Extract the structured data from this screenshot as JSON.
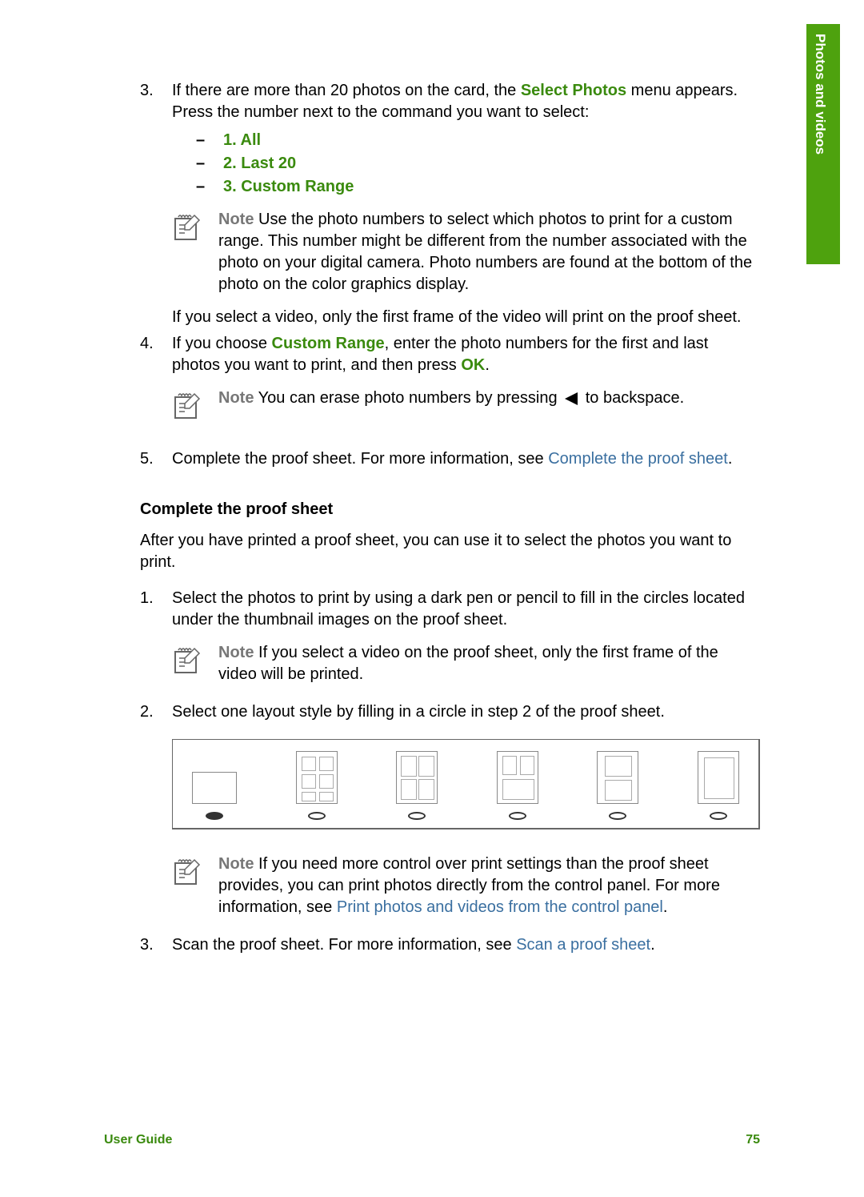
{
  "side_tab": "Photos and videos",
  "step3": {
    "num": "3.",
    "text_a": "If there are more than 20 photos on the card, the ",
    "select_photos": "Select Photos",
    "text_b": " menu appears. Press the number next to the command you want to select:",
    "opt1": "1. All",
    "opt2": "2. Last 20",
    "opt3": "3. Custom Range",
    "note_label": "Note",
    "note_body": "  Use the photo numbers to select which photos to print for a custom range. This number might be different from the number associated with the photo on your digital camera. Photo numbers are found at the bottom of the photo on the color graphics display.",
    "video_line": "If you select a video, only the first frame of the video will print on the proof sheet."
  },
  "step4": {
    "num": "4.",
    "text_a": "If you choose ",
    "custom_range": "Custom Range",
    "text_b": ", enter the photo numbers for the first and last photos you want to print, and then press ",
    "ok": "OK",
    "text_c": ".",
    "note_label": "Note",
    "note_a": "  You can erase photo numbers by pressing ",
    "note_b": " to backspace."
  },
  "step5": {
    "num": "5.",
    "text_a": "Complete the proof sheet. For more information, see ",
    "link": "Complete the proof sheet",
    "text_b": "."
  },
  "section2": {
    "heading": "Complete the proof sheet",
    "intro": "After you have printed a proof sheet, you can use it to select the photos you want to print.",
    "s1": {
      "num": "1.",
      "text": "Select the photos to print by using a dark pen or pencil to fill in the circles located under the thumbnail images on the proof sheet.",
      "note_label": "Note",
      "note_body": "  If you select a video on the proof sheet, only the first frame of the video will be printed."
    },
    "s2": {
      "num": "2.",
      "text": "Select one layout style by filling in a circle in step 2 of the proof sheet.",
      "note_label": "Note",
      "note_a": "  If you need more control over print settings than the proof sheet provides, you can print photos directly from the control panel. For more information, see ",
      "link": "Print photos and videos from the control panel",
      "note_b": "."
    },
    "s3": {
      "num": "3.",
      "text_a": "Scan the proof sheet. For more information, see ",
      "link": "Scan a proof sheet",
      "text_b": "."
    }
  },
  "footer": {
    "left": "User Guide",
    "right": "75"
  }
}
